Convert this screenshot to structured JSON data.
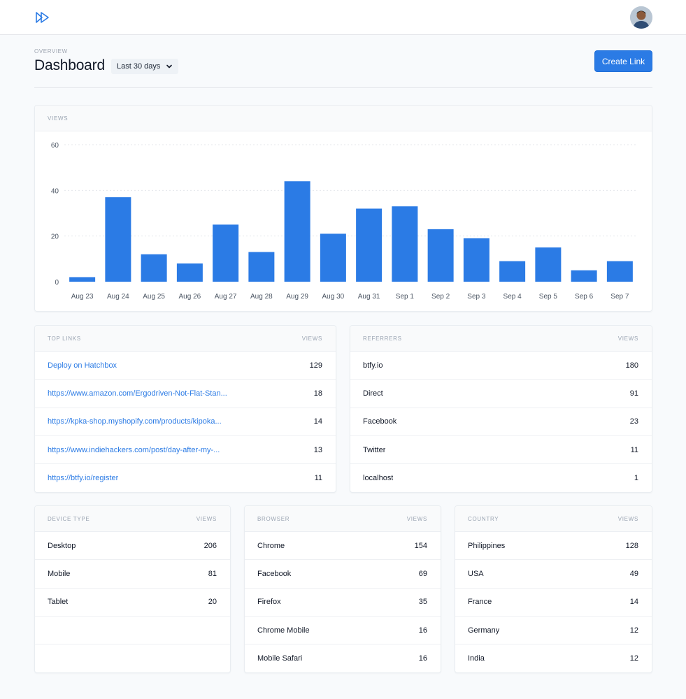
{
  "header": {
    "logo_icon": "fast-forward-logo-icon",
    "avatar": "user-avatar"
  },
  "page": {
    "eyebrow": "OVERVIEW",
    "title": "Dashboard",
    "range_label": "Last 30 days",
    "create_button": "Create Link"
  },
  "colors": {
    "accent": "#2b7be5",
    "bar": "#2b7be5",
    "link": "#2b7be5"
  },
  "chart_data": {
    "type": "bar",
    "title": "VIEWS",
    "categories": [
      "Aug 23",
      "Aug 24",
      "Aug 25",
      "Aug 26",
      "Aug 27",
      "Aug 28",
      "Aug 29",
      "Aug 30",
      "Aug 31",
      "Sep 1",
      "Sep 2",
      "Sep 3",
      "Sep 4",
      "Sep 5",
      "Sep 6",
      "Sep 7"
    ],
    "values": [
      2,
      37,
      12,
      8,
      25,
      13,
      44,
      21,
      32,
      33,
      23,
      19,
      9,
      15,
      5,
      9
    ],
    "ylim": [
      0,
      60
    ],
    "yticks": [
      0,
      20,
      40,
      60
    ],
    "grid": true
  },
  "top_links": {
    "title": "TOP LINKS",
    "col": "VIEWS",
    "rows": [
      {
        "label": "Deploy on Hatchbox",
        "value": "129"
      },
      {
        "label": "https://www.amazon.com/Ergodriven-Not-Flat-Stan...",
        "value": "18"
      },
      {
        "label": "https://kpka-shop.myshopify.com/products/kipoka...",
        "value": "14"
      },
      {
        "label": "https://www.indiehackers.com/post/day-after-my-...",
        "value": "13"
      },
      {
        "label": "https://btfy.io/register",
        "value": "11"
      }
    ]
  },
  "referrers": {
    "title": "REFERRERS",
    "col": "VIEWS",
    "rows": [
      {
        "label": "btfy.io",
        "value": "180"
      },
      {
        "label": "Direct",
        "value": "91"
      },
      {
        "label": "Facebook",
        "value": "23"
      },
      {
        "label": "Twitter",
        "value": "11"
      },
      {
        "label": "localhost",
        "value": "1"
      }
    ]
  },
  "device_type": {
    "title": "DEVICE TYPE",
    "col": "VIEWS",
    "rows": [
      {
        "label": "Desktop",
        "value": "206"
      },
      {
        "label": "Mobile",
        "value": "81"
      },
      {
        "label": "Tablet",
        "value": "20"
      }
    ]
  },
  "browser": {
    "title": "BROWSER",
    "col": "VIEWS",
    "rows": [
      {
        "label": "Chrome",
        "value": "154"
      },
      {
        "label": "Facebook",
        "value": "69"
      },
      {
        "label": "Firefox",
        "value": "35"
      },
      {
        "label": "Chrome Mobile",
        "value": "16"
      },
      {
        "label": "Mobile Safari",
        "value": "16"
      }
    ]
  },
  "country": {
    "title": "COUNTRY",
    "col": "VIEWS",
    "rows": [
      {
        "label": "Philippines",
        "value": "128"
      },
      {
        "label": "USA",
        "value": "49"
      },
      {
        "label": "France",
        "value": "14"
      },
      {
        "label": "Germany",
        "value": "12"
      },
      {
        "label": "India",
        "value": "12"
      }
    ]
  }
}
